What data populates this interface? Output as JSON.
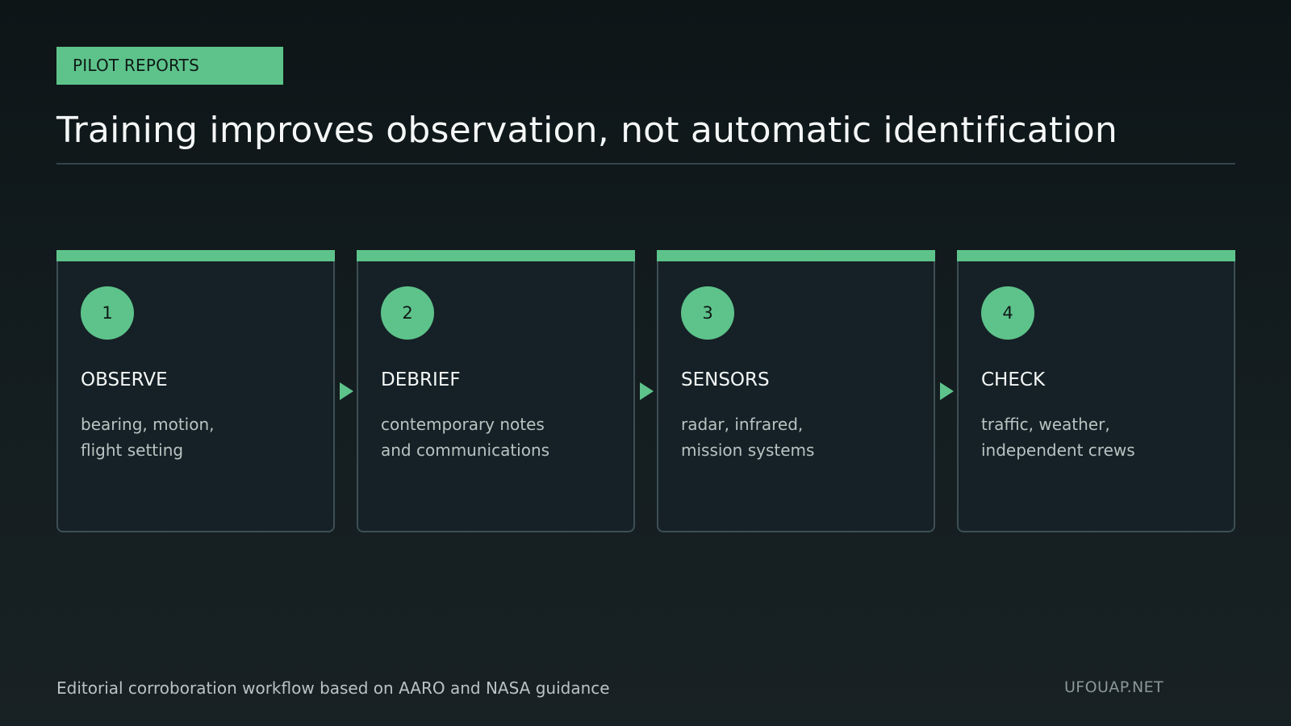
{
  "tag": "PILOT REPORTS",
  "title": "Training improves observation, not automatic identification",
  "steps": [
    {
      "number": "1",
      "heading": "OBSERVE",
      "lines": [
        "bearing, motion,",
        "flight setting"
      ]
    },
    {
      "number": "2",
      "heading": "DEBRIEF",
      "lines": [
        "contemporary notes",
        "and communications"
      ]
    },
    {
      "number": "3",
      "heading": "SENSORS",
      "lines": [
        "radar, infrared,",
        "mission systems"
      ]
    },
    {
      "number": "4",
      "heading": "CHECK",
      "lines": [
        "traffic, weather,",
        "independent crews"
      ]
    }
  ],
  "footer": {
    "caption": "Editorial corroboration workflow based on AARO and NASA guidance",
    "brand": "UFOUAP.NET"
  },
  "colors": {
    "accent": "#5ec38b",
    "card_background": "#152126",
    "card_border": "#3d4f55",
    "page_background": "#111a1d"
  }
}
